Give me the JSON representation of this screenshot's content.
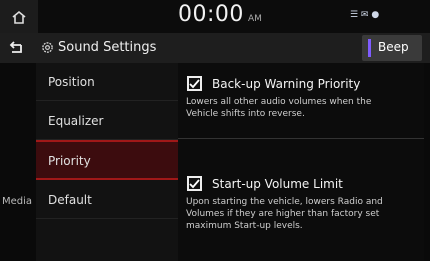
{
  "status": {
    "time": "00:00",
    "ampm": "AM",
    "icons": "☰ ✉ ●"
  },
  "header": {
    "title": "Sound Settings",
    "beep_label": "Beep"
  },
  "side": {
    "media_label": "Media"
  },
  "menu": {
    "items": [
      {
        "label": "Position"
      },
      {
        "label": "Equalizer"
      },
      {
        "label": "Priority"
      },
      {
        "label": "Default"
      }
    ],
    "selected_index": 2
  },
  "options": [
    {
      "title": "Back-up Warning Priority",
      "checked": true,
      "desc_1": "Lowers all other audio volumes when the",
      "desc_2": "Vehicle shifts into reverse."
    },
    {
      "title": "Start-up Volume Limit",
      "checked": true,
      "desc_1": "Upon starting the vehicle, lowers Radio and",
      "desc_2": "Volumes if they are higher than factory set",
      "desc_3": "maximum Start-up levels."
    }
  ],
  "colors": {
    "accent_beep": "#7f5cff",
    "selected_bg": "#3c0c0e",
    "selected_border": "#a01818"
  }
}
